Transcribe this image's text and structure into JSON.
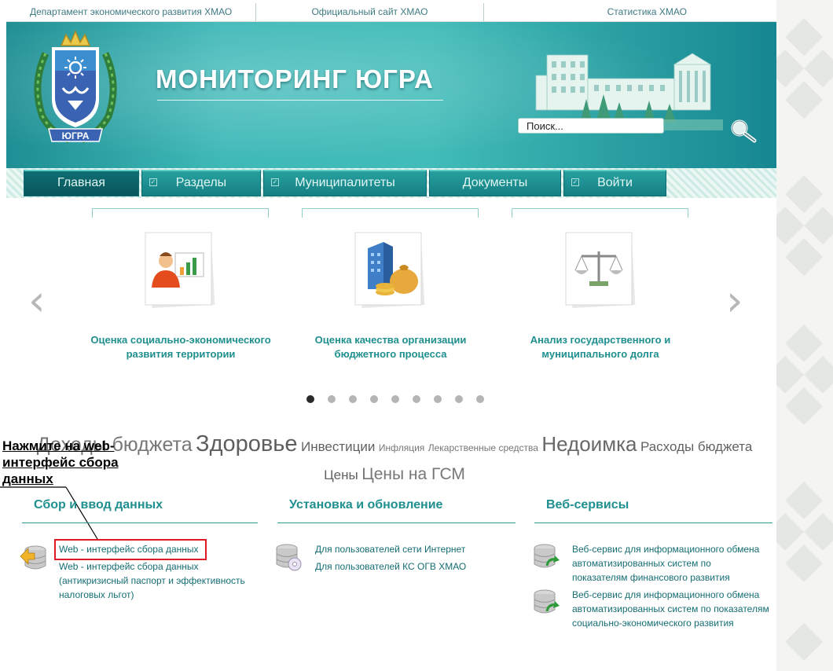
{
  "top_links": [
    "Департамент экономического развития ХМАО",
    "Официальный сайт ХМАО",
    "Статистика ХМАО"
  ],
  "header": {
    "title": "МОНИТОРИНГ ЮГРА",
    "emblem_text": "ЮГРА",
    "search_value": "Поиск..."
  },
  "nav": {
    "items": [
      "Главная",
      "Разделы",
      "Муниципалитеты",
      "Документы",
      "Войти"
    ]
  },
  "carousel": {
    "cards": [
      {
        "title": "Оценка социально-экономического развития территории",
        "icon": "social-assessment-icon"
      },
      {
        "title": "Оценка качества организации бюджетного процесса",
        "icon": "budget-quality-icon"
      },
      {
        "title": "Анализ государственного и муниципального долга",
        "icon": "debt-analysis-icon"
      }
    ],
    "total_slides": 9,
    "active_slide": 1
  },
  "tag_cloud": [
    "Доходы бюджета",
    "Здоровье",
    "Инвестиции",
    "Инфляция",
    "Лекарственные средства",
    "Недоимка",
    "Расходы бюджета",
    "Цены",
    "Цены на ГСМ"
  ],
  "annotation": {
    "text": "Нажмите на web-интерфейс сбора данных"
  },
  "sections": [
    {
      "title": "Сбор и ввод данных",
      "links": [
        "Web - интерфейс сбора данных",
        "Web - интерфейс сбора данных (антикризисный паспорт и эффективность налоговых льгот)"
      ]
    },
    {
      "title": "Установка и обновление",
      "links": [
        "Для пользователей сети Интернет",
        "Для пользователей КС ОГВ ХМАО"
      ]
    },
    {
      "title": "Веб-сервисы",
      "links": [
        "Веб-сервис для информационного обмена автоматизированных систем по показателям финансового развития",
        "Веб-сервис для информационного обмена автоматизированных систем по показателям социально-экономического развития"
      ]
    }
  ],
  "colors": {
    "teal_accent": "#1f8f8f",
    "link": "#156d74",
    "highlight": "#e01a22"
  }
}
